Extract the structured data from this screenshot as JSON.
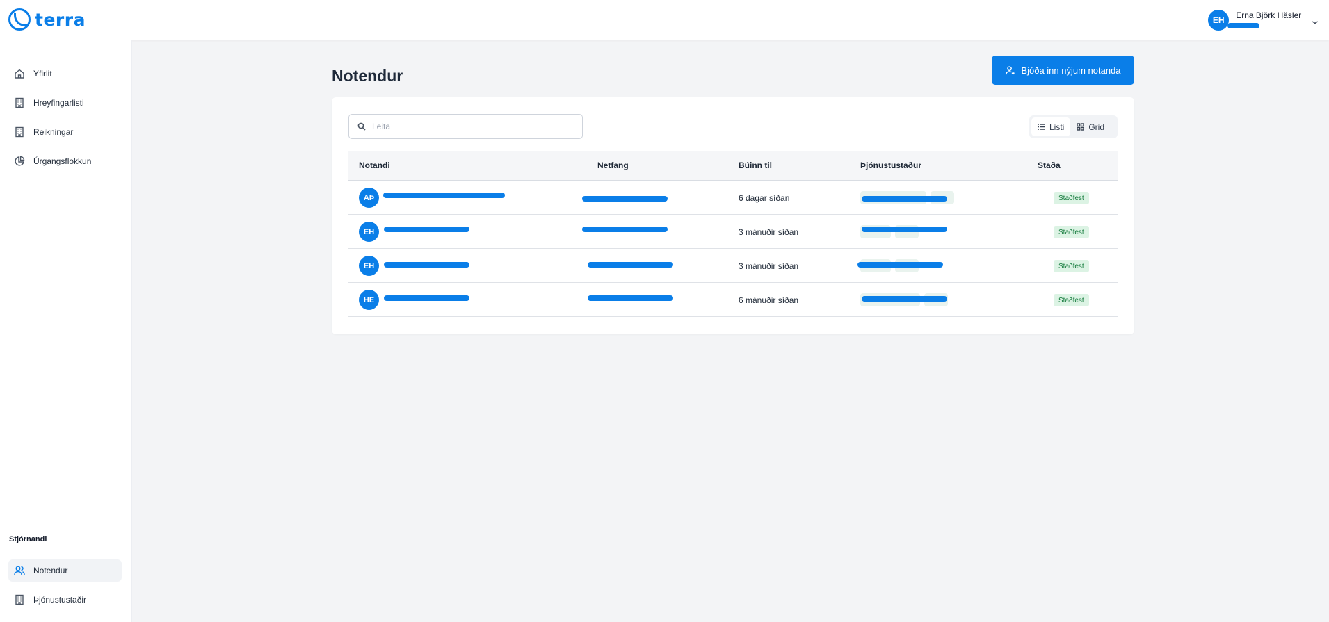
{
  "header": {
    "logo_text": "terra",
    "user_initials": "EH",
    "user_name": "Erna Björk Häsler"
  },
  "sidebar": {
    "items": [
      {
        "label": "Yfirlit",
        "icon": "home-icon"
      },
      {
        "label": "Hreyfingarlisti",
        "icon": "building-icon"
      },
      {
        "label": "Reikningar",
        "icon": "building-icon"
      },
      {
        "label": "Úrgangsflokkun",
        "icon": "pie-chart-icon"
      }
    ],
    "admin_section_label": "Stjórnandi",
    "admin_items": [
      {
        "label": "Notendur",
        "icon": "users-icon",
        "active": true
      },
      {
        "label": "Þjónustustaðir",
        "icon": "building-icon"
      }
    ]
  },
  "main": {
    "title": "Notendur",
    "invite_button_label": "Bjóða inn nýjum notanda",
    "search_placeholder": "Leita",
    "view_options": {
      "list": "Listi",
      "grid": "Grid",
      "selected": "list"
    },
    "columns": [
      "Notandi",
      "Netfang",
      "Búinn til",
      "Þjónustustaður",
      "Staða"
    ],
    "rows": [
      {
        "initials": "AÞ",
        "created": "6 dagar síðan",
        "status": "Staðfest"
      },
      {
        "initials": "EH",
        "created": "3 mánuðir síðan",
        "status": "Staðfest"
      },
      {
        "initials": "EH",
        "created": "3 mánuðir síðan",
        "status": "Staðfest"
      },
      {
        "initials": "HE",
        "created": "6 mánuðir síðan",
        "status": "Staðfest"
      }
    ]
  },
  "colors": {
    "accent": "#0a7ee8",
    "status_bg": "#dcf3e4",
    "status_text": "#137a3b",
    "page_bg": "#f3f4f6"
  }
}
